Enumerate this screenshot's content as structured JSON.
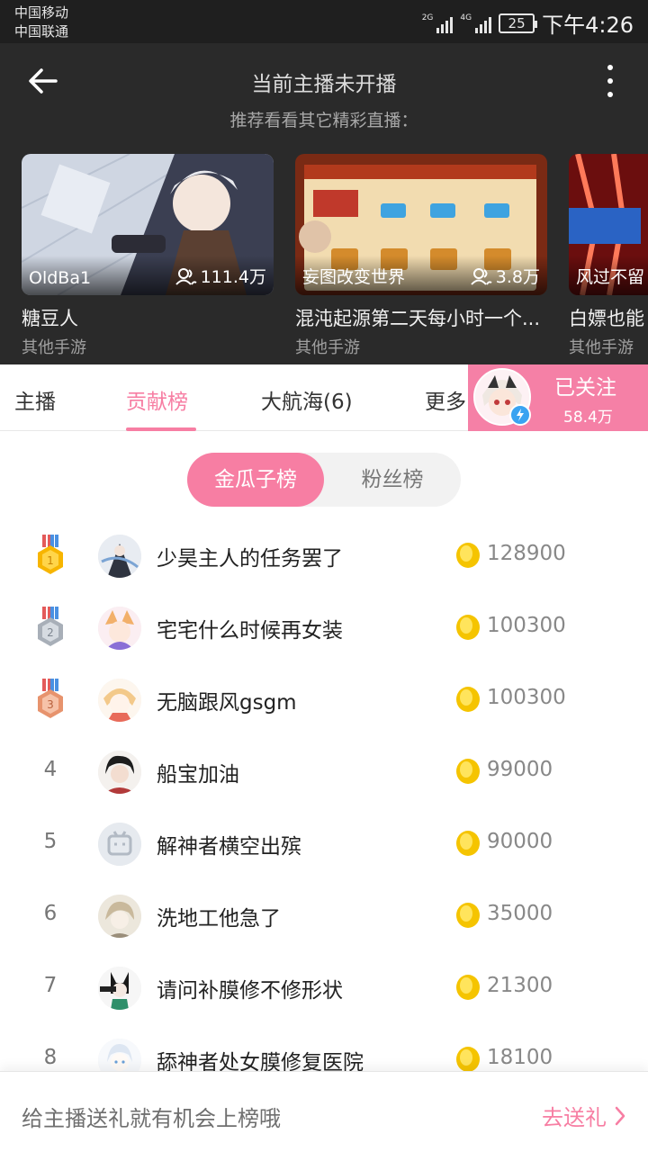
{
  "status_bar": {
    "carrier1": "中国移动",
    "carrier2": "中国联通",
    "sig1_label": "2G",
    "sig2_label": "4G",
    "battery": "25",
    "time": "下午4:26"
  },
  "header": {
    "title": "当前主播未开播",
    "subtitle": "推荐看看其它精彩直播："
  },
  "recommendations": [
    {
      "streamer": "OldBa1",
      "views": "111.4万",
      "title": "糖豆人",
      "category": "其他手游"
    },
    {
      "streamer": "妄图改变世界",
      "views": "3.8万",
      "title": "混沌起源第二天每小时一个...",
      "category": "其他手游"
    },
    {
      "streamer": "风过不留",
      "views": "",
      "title": "白嫖也能",
      "category": "其他手游"
    }
  ],
  "tabs": {
    "anchor": "主播",
    "contribution": "贡献榜",
    "voyage": "大航海(6)",
    "more": "更多"
  },
  "follow": {
    "label": "已关注",
    "count": "58.4万"
  },
  "toggle": {
    "gold": "金瓜子榜",
    "fans": "粉丝榜"
  },
  "ranking": [
    {
      "rank": "1",
      "name": "少昊主人的任务罢了",
      "score": "128900"
    },
    {
      "rank": "2",
      "name": "宅宅什么时候再女装",
      "score": "100300"
    },
    {
      "rank": "3",
      "name": "无脑跟风gsgm",
      "score": "100300"
    },
    {
      "rank": "4",
      "name": "船宝加油",
      "score": "99000"
    },
    {
      "rank": "5",
      "name": "解神者横空出殡",
      "score": "90000"
    },
    {
      "rank": "6",
      "name": "洗地工他急了",
      "score": "35000"
    },
    {
      "rank": "7",
      "name": "请问补膜修不修形状",
      "score": "21300"
    },
    {
      "rank": "8",
      "name": "舔神者处女膜修复医院",
      "score": "18100"
    }
  ],
  "bottom": {
    "hint": "给主播送礼就有机会上榜哦",
    "action": "去送礼"
  },
  "colors": {
    "accent": "#f77ea3",
    "header_bg": "#2a2a2a",
    "gold": "#f5c400"
  }
}
